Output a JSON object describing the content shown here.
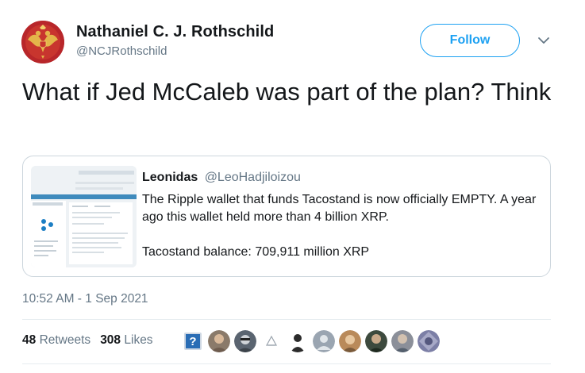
{
  "author": {
    "name": "Nathaniel C. J. Rothschild",
    "handle": "@NCJRothschild",
    "avatar_icon": "double-headed-eagle-crest-icon"
  },
  "follow_label": "Follow",
  "tweet_text": "What if Jed McCaleb was part of the plan? Think",
  "quoted": {
    "name": "Leonidas",
    "handle": "@LeoHadjiloizou",
    "paragraph1": "The Ripple wallet that funds Tacostand is now officially EMPTY. A year ago this wallet held more than 4 billion XRP.",
    "paragraph2": "Tacostand balance: 709,911 million XRP",
    "thumbnail_icon": "ripple-wallet-screenshot-thumbnail"
  },
  "timestamp": "10:52 AM - 1 Sep 2021",
  "stats": {
    "retweets_count": "48",
    "retweets_label": "Retweets",
    "likes_count": "308",
    "likes_label": "Likes"
  },
  "liker_avatars": [
    {
      "icon": "help-question-avatar",
      "color": "#2a6db5"
    },
    {
      "icon": "person-avatar",
      "color": "#8a7a6a"
    },
    {
      "icon": "person-avatar",
      "color": "#5a6470"
    },
    {
      "icon": "outline-logo-avatar",
      "color": "#ffffff"
    },
    {
      "icon": "person-avatar",
      "color": "#2b2b2b"
    },
    {
      "icon": "default-person-avatar",
      "color": "#9aa5b1"
    },
    {
      "icon": "person-avatar",
      "color": "#b98a5a"
    },
    {
      "icon": "person-avatar",
      "color": "#3d4a3e"
    },
    {
      "icon": "person-avatar",
      "color": "#8b8f99"
    },
    {
      "icon": "mosaic-avatar",
      "color": "#7c7fa6"
    }
  ],
  "colors": {
    "accent": "#1da1f2",
    "text": "#14171a",
    "muted": "#657786",
    "border": "#ccd6dd"
  }
}
